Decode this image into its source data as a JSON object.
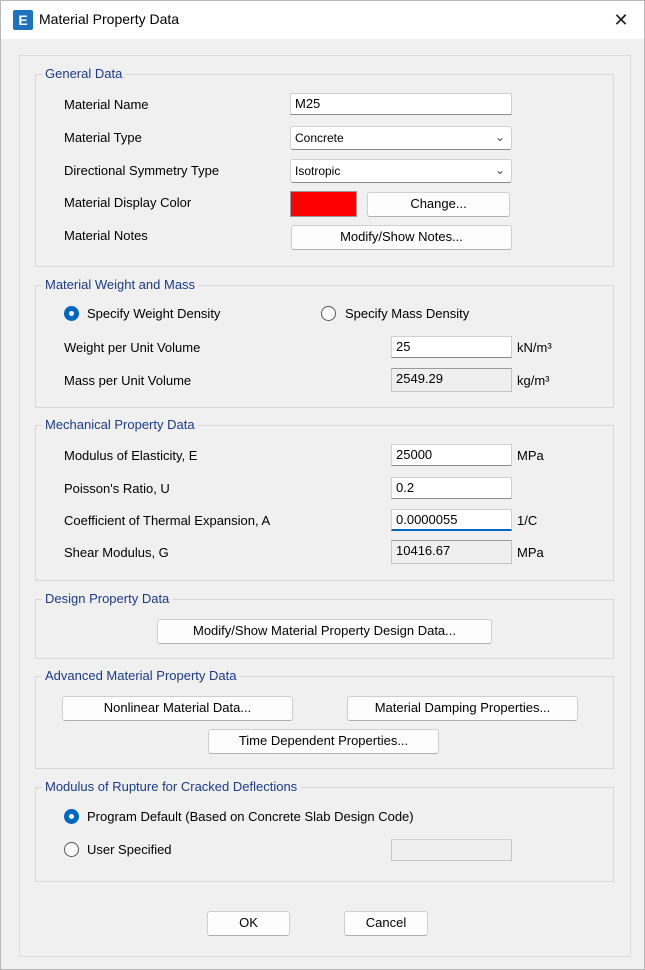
{
  "window": {
    "title": "Material Property Data",
    "icon_letter": "E",
    "close_glyph": "✕"
  },
  "general": {
    "title": "General Data",
    "material_name_label": "Material Name",
    "material_name_value": "M25",
    "material_type_label": "Material Type",
    "material_type_value": "Concrete",
    "symmetry_label": "Directional Symmetry Type",
    "symmetry_value": "Isotropic",
    "display_color_label": "Material Display Color",
    "display_color": "#ff0000",
    "change_button": "Change...",
    "notes_label": "Material Notes",
    "notes_button": "Modify/Show Notes..."
  },
  "weight": {
    "title": "Material Weight and Mass",
    "radio_weight": "Specify Weight Density",
    "radio_mass": "Specify Mass Density",
    "selected": "weight",
    "weight_label": "Weight per Unit Volume",
    "weight_value": "25",
    "weight_unit": "kN/m³",
    "mass_label": "Mass per Unit Volume",
    "mass_value": "2549.29",
    "mass_unit": "kg/m³"
  },
  "mechanical": {
    "title": "Mechanical Property Data",
    "modulus_label": "Modulus of Elasticity,  E",
    "modulus_value": "25000",
    "modulus_unit": "MPa",
    "poisson_label": "Poisson's Ratio,  U",
    "poisson_value": "0.2",
    "thermal_label": "Coefficient of Thermal Expansion,  A",
    "thermal_value": "0.0000055",
    "thermal_unit": "1/C",
    "shear_label": "Shear Modulus,  G",
    "shear_value": "10416.67",
    "shear_unit": "MPa"
  },
  "design": {
    "title": "Design Property Data",
    "button": "Modify/Show Material Property Design Data..."
  },
  "advanced": {
    "title": "Advanced Material Property Data",
    "nonlinear_button": "Nonlinear Material Data...",
    "damping_button": "Material Damping Properties...",
    "time_button": "Time Dependent Properties..."
  },
  "rupture": {
    "title": "Modulus of Rupture for Cracked Deflections",
    "radio_default": "Program Default  (Based on Concrete Slab Design Code)",
    "radio_user": "User Specified",
    "selected": "default",
    "user_value": ""
  },
  "footer": {
    "ok": "OK",
    "cancel": "Cancel"
  }
}
